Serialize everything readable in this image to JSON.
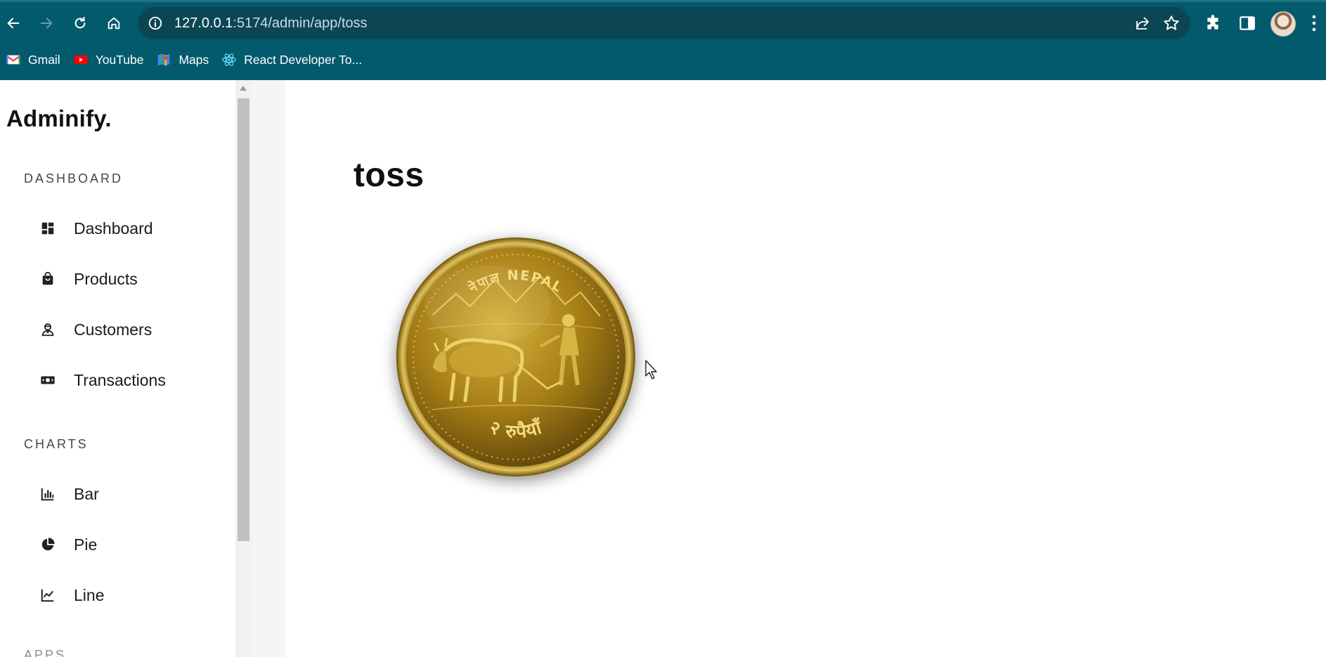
{
  "browser": {
    "url_host": "127.0.0.1",
    "url_path": ":5174/admin/app/toss",
    "icons": [
      "back-icon",
      "forward-icon",
      "reload-icon",
      "home-icon",
      "info-icon",
      "share-icon",
      "star-icon",
      "extensions-icon",
      "side-panel-icon",
      "kebab-menu-icon"
    ],
    "bookmarks": [
      {
        "label": "Gmail",
        "icon": "gmail-icon"
      },
      {
        "label": "YouTube",
        "icon": "youtube-icon"
      },
      {
        "label": "Maps",
        "icon": "maps-icon"
      },
      {
        "label": "React Developer To...",
        "icon": "react-icon"
      }
    ]
  },
  "sidebar": {
    "brand": "Adminify.",
    "sections": [
      {
        "title": "DASHBOARD",
        "items": [
          {
            "label": "Dashboard",
            "icon": "dashboard-icon"
          },
          {
            "label": "Products",
            "icon": "shopping-bag-icon"
          },
          {
            "label": "Customers",
            "icon": "customer-icon"
          },
          {
            "label": "Transactions",
            "icon": "money-icon"
          }
        ]
      },
      {
        "title": "CHARTS",
        "items": [
          {
            "label": "Bar",
            "icon": "bar-chart-icon"
          },
          {
            "label": "Pie",
            "icon": "pie-chart-icon"
          },
          {
            "label": "Line",
            "icon": "line-chart-icon"
          }
        ]
      }
    ],
    "next_section_peek": "APPS"
  },
  "main": {
    "title": "toss",
    "coin": {
      "top_text": "नेपाल NEPAL",
      "bottom_text": "२ रुपैयाँ"
    }
  },
  "colors": {
    "chrome": "#035a6c",
    "omnibox": "#0c4655",
    "coin_gold": "#b8921e"
  }
}
